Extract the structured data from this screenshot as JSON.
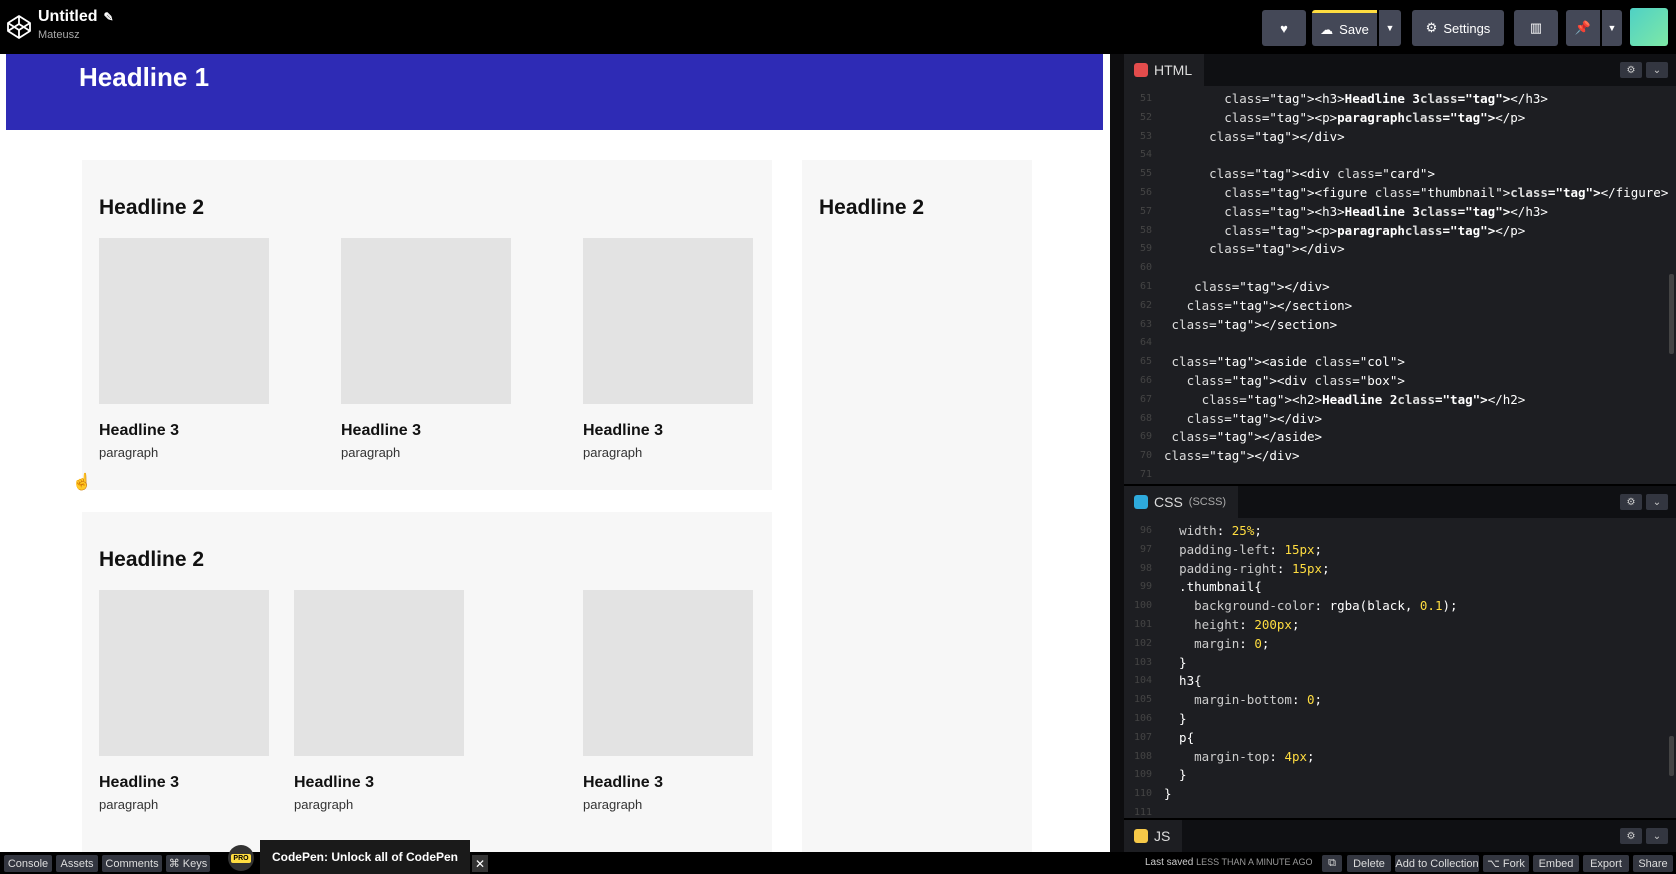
{
  "header": {
    "title": "Untitled",
    "user": "Mateusz",
    "buttons": {
      "save": "Save",
      "settings": "Settings"
    }
  },
  "preview": {
    "headline1": "Headline 1",
    "section1": {
      "headline2": "Headline 2",
      "cards": [
        {
          "h3": "Headline 3",
          "p": "paragraph"
        },
        {
          "h3": "Headline 3",
          "p": "paragraph"
        },
        {
          "h3": "Headline 3",
          "p": "paragraph"
        }
      ]
    },
    "section2": {
      "headline2": "Headline 2",
      "cards": [
        {
          "h3": "Headline 3",
          "p": "paragraph"
        },
        {
          "h3": "Headline 3",
          "p": "paragraph"
        },
        {
          "h3": "Headline 3",
          "p": "paragraph"
        }
      ]
    },
    "aside": {
      "headline2": "Headline 2"
    }
  },
  "editors": {
    "html": {
      "label": "HTML",
      "lines": [
        "        <h3>Headline 3</h3>",
        "        <p>paragraph</p>",
        "      </div>",
        "",
        "      <div class=\"card\">",
        "        <figure class=\"thumbnail\"></figure>",
        "        <h3>Headline 3</h3>",
        "        <p>paragraph</p>",
        "      </div>",
        "",
        "    </div>",
        "   </section>",
        " </section>",
        "",
        " <aside class=\"col\">",
        "   <div class=\"box\">",
        "     <h2>Headline 2</h2>",
        "   </div>",
        " </aside>",
        "</div>",
        ""
      ]
    },
    "css": {
      "label": "CSS",
      "sublabel": "(SCSS)",
      "lines": [
        "  width: 25%;",
        "  padding-left: 15px;",
        "  padding-right: 15px;",
        "  .thumbnail{",
        "    background-color: rgba(black, 0.1);",
        "    height: 200px;",
        "    margin: 0;",
        "  }",
        "  h3{",
        "    margin-bottom: 0;",
        "  }",
        "  p{",
        "    margin-top: 4px;",
        "  }",
        "}",
        ""
      ]
    },
    "js": {
      "label": "JS"
    }
  },
  "footer": {
    "console": "Console",
    "assets": "Assets",
    "comments": "Comments",
    "keys": "⌘ Keys",
    "pro_badge": "PRO",
    "promo": "CodePen: Unlock all of CodePen",
    "last_saved": "Last saved",
    "last_saved_time": "LESS THAN A MINUTE AGO",
    "delete": "Delete",
    "add_to_collection": "Add to Collection",
    "fork": "⌥ Fork",
    "embed": "Embed",
    "export": "Export",
    "share": "Share"
  },
  "colors": {
    "hero": "#2e2bb5",
    "accent": "#ffdd40",
    "editor_bg": "#1d1e22",
    "button_bg": "#444857"
  }
}
